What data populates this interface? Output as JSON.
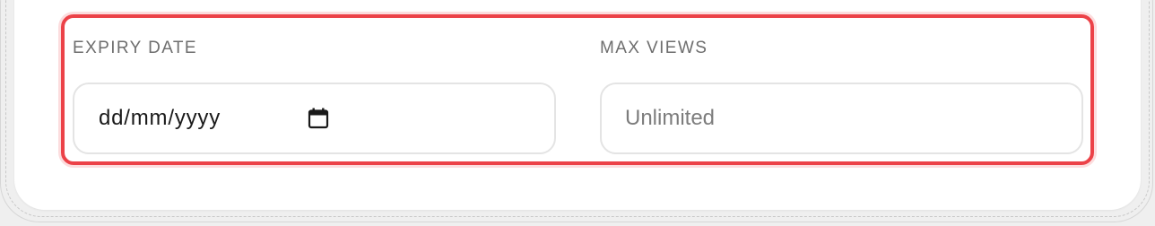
{
  "expiry": {
    "label": "EXPIRY DATE",
    "placeholder": "dd/mm/yyyy",
    "icon": "calendar-icon"
  },
  "max_views": {
    "label": "MAX VIEWS",
    "placeholder": "Unlimited",
    "value": ""
  },
  "colors": {
    "highlight": "#ec4248",
    "label": "#6e6e6e",
    "input_border": "#e4e4e4"
  }
}
